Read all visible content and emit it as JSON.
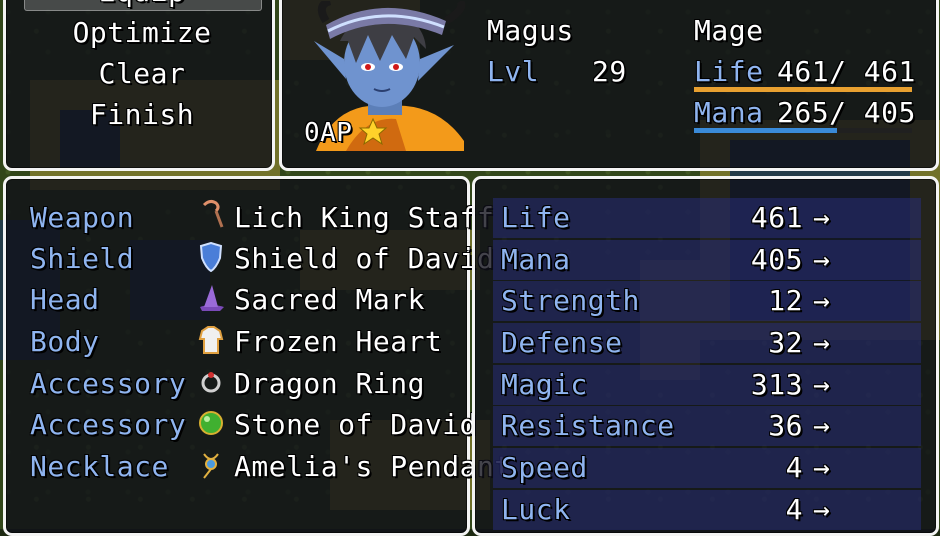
{
  "command_menu": {
    "items": [
      "Equip",
      "Optimize",
      "Clear",
      "Finish"
    ],
    "selected": "Equip"
  },
  "actor": {
    "name": "Magus",
    "class": "Mage",
    "level_label": "Lvl",
    "level": "29",
    "ap": "0AP",
    "life_label": "Life",
    "life_value": "461/ 461",
    "life_fraction": 1.0,
    "mana_label": "Mana",
    "mana_value": "265/ 405",
    "mana_fraction": 0.654
  },
  "equipment": [
    {
      "slot": "Weapon",
      "item": "Lich King Staff",
      "icon": "staff-icon"
    },
    {
      "slot": "Shield",
      "item": "Shield of David",
      "icon": "shield-icon"
    },
    {
      "slot": "Head",
      "item": "Sacred Mark",
      "icon": "wizard-hat-icon"
    },
    {
      "slot": "Body",
      "item": "Frozen Heart",
      "icon": "robe-icon"
    },
    {
      "slot": "Accessory",
      "item": "Dragon Ring",
      "icon": "ring-icon"
    },
    {
      "slot": "Accessory",
      "item": "Stone of David",
      "icon": "green-orb-icon"
    },
    {
      "slot": "Necklace",
      "item": "Amelia's Pendant",
      "icon": "pendant-icon"
    }
  ],
  "stats": [
    {
      "name": "Life",
      "value": "461",
      "arrow": "→"
    },
    {
      "name": "Mana",
      "value": "405",
      "arrow": "→"
    },
    {
      "name": "Strength",
      "value": "12",
      "arrow": "→"
    },
    {
      "name": "Defense",
      "value": "32",
      "arrow": "→"
    },
    {
      "name": "Magic",
      "value": "313",
      "arrow": "→"
    },
    {
      "name": "Resistance",
      "value": "36",
      "arrow": "→"
    },
    {
      "name": "Speed",
      "value": "4",
      "arrow": "→"
    },
    {
      "name": "Luck",
      "value": "4",
      "arrow": "→"
    }
  ],
  "colors": {
    "label_blue": "#8fb4ef",
    "life_bar": "#e8a030",
    "mana_bar": "#3a8ad8",
    "stat_row": "#282e78"
  }
}
